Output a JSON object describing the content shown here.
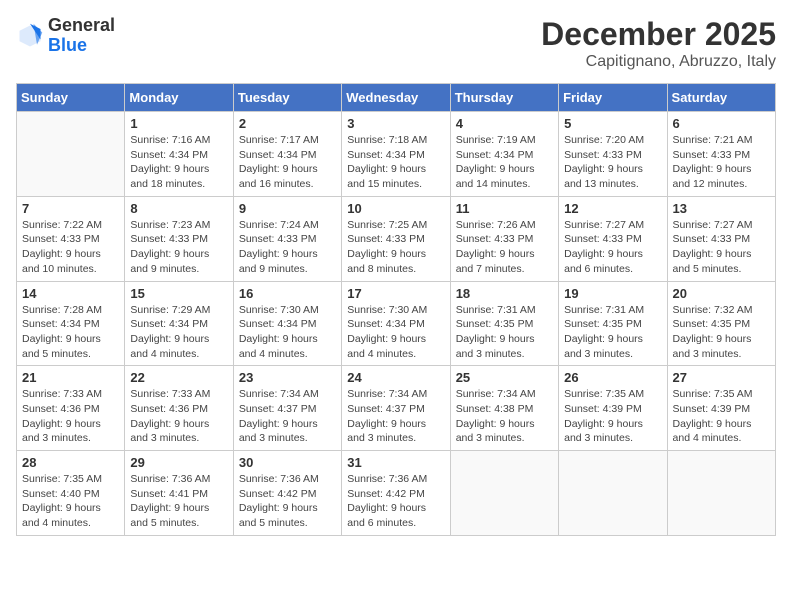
{
  "header": {
    "logo_general": "General",
    "logo_blue": "Blue",
    "month_title": "December 2025",
    "location": "Capitignano, Abruzzo, Italy"
  },
  "days_of_week": [
    "Sunday",
    "Monday",
    "Tuesday",
    "Wednesday",
    "Thursday",
    "Friday",
    "Saturday"
  ],
  "weeks": [
    [
      {
        "day": "",
        "info": ""
      },
      {
        "day": "1",
        "info": "Sunrise: 7:16 AM\nSunset: 4:34 PM\nDaylight: 9 hours\nand 18 minutes."
      },
      {
        "day": "2",
        "info": "Sunrise: 7:17 AM\nSunset: 4:34 PM\nDaylight: 9 hours\nand 16 minutes."
      },
      {
        "day": "3",
        "info": "Sunrise: 7:18 AM\nSunset: 4:34 PM\nDaylight: 9 hours\nand 15 minutes."
      },
      {
        "day": "4",
        "info": "Sunrise: 7:19 AM\nSunset: 4:34 PM\nDaylight: 9 hours\nand 14 minutes."
      },
      {
        "day": "5",
        "info": "Sunrise: 7:20 AM\nSunset: 4:33 PM\nDaylight: 9 hours\nand 13 minutes."
      },
      {
        "day": "6",
        "info": "Sunrise: 7:21 AM\nSunset: 4:33 PM\nDaylight: 9 hours\nand 12 minutes."
      }
    ],
    [
      {
        "day": "7",
        "info": "Sunrise: 7:22 AM\nSunset: 4:33 PM\nDaylight: 9 hours\nand 10 minutes."
      },
      {
        "day": "8",
        "info": "Sunrise: 7:23 AM\nSunset: 4:33 PM\nDaylight: 9 hours\nand 9 minutes."
      },
      {
        "day": "9",
        "info": "Sunrise: 7:24 AM\nSunset: 4:33 PM\nDaylight: 9 hours\nand 9 minutes."
      },
      {
        "day": "10",
        "info": "Sunrise: 7:25 AM\nSunset: 4:33 PM\nDaylight: 9 hours\nand 8 minutes."
      },
      {
        "day": "11",
        "info": "Sunrise: 7:26 AM\nSunset: 4:33 PM\nDaylight: 9 hours\nand 7 minutes."
      },
      {
        "day": "12",
        "info": "Sunrise: 7:27 AM\nSunset: 4:33 PM\nDaylight: 9 hours\nand 6 minutes."
      },
      {
        "day": "13",
        "info": "Sunrise: 7:27 AM\nSunset: 4:33 PM\nDaylight: 9 hours\nand 5 minutes."
      }
    ],
    [
      {
        "day": "14",
        "info": "Sunrise: 7:28 AM\nSunset: 4:34 PM\nDaylight: 9 hours\nand 5 minutes."
      },
      {
        "day": "15",
        "info": "Sunrise: 7:29 AM\nSunset: 4:34 PM\nDaylight: 9 hours\nand 4 minutes."
      },
      {
        "day": "16",
        "info": "Sunrise: 7:30 AM\nSunset: 4:34 PM\nDaylight: 9 hours\nand 4 minutes."
      },
      {
        "day": "17",
        "info": "Sunrise: 7:30 AM\nSunset: 4:34 PM\nDaylight: 9 hours\nand 4 minutes."
      },
      {
        "day": "18",
        "info": "Sunrise: 7:31 AM\nSunset: 4:35 PM\nDaylight: 9 hours\nand 3 minutes."
      },
      {
        "day": "19",
        "info": "Sunrise: 7:31 AM\nSunset: 4:35 PM\nDaylight: 9 hours\nand 3 minutes."
      },
      {
        "day": "20",
        "info": "Sunrise: 7:32 AM\nSunset: 4:35 PM\nDaylight: 9 hours\nand 3 minutes."
      }
    ],
    [
      {
        "day": "21",
        "info": "Sunrise: 7:33 AM\nSunset: 4:36 PM\nDaylight: 9 hours\nand 3 minutes."
      },
      {
        "day": "22",
        "info": "Sunrise: 7:33 AM\nSunset: 4:36 PM\nDaylight: 9 hours\nand 3 minutes."
      },
      {
        "day": "23",
        "info": "Sunrise: 7:34 AM\nSunset: 4:37 PM\nDaylight: 9 hours\nand 3 minutes."
      },
      {
        "day": "24",
        "info": "Sunrise: 7:34 AM\nSunset: 4:37 PM\nDaylight: 9 hours\nand 3 minutes."
      },
      {
        "day": "25",
        "info": "Sunrise: 7:34 AM\nSunset: 4:38 PM\nDaylight: 9 hours\nand 3 minutes."
      },
      {
        "day": "26",
        "info": "Sunrise: 7:35 AM\nSunset: 4:39 PM\nDaylight: 9 hours\nand 3 minutes."
      },
      {
        "day": "27",
        "info": "Sunrise: 7:35 AM\nSunset: 4:39 PM\nDaylight: 9 hours\nand 4 minutes."
      }
    ],
    [
      {
        "day": "28",
        "info": "Sunrise: 7:35 AM\nSunset: 4:40 PM\nDaylight: 9 hours\nand 4 minutes."
      },
      {
        "day": "29",
        "info": "Sunrise: 7:36 AM\nSunset: 4:41 PM\nDaylight: 9 hours\nand 5 minutes."
      },
      {
        "day": "30",
        "info": "Sunrise: 7:36 AM\nSunset: 4:42 PM\nDaylight: 9 hours\nand 5 minutes."
      },
      {
        "day": "31",
        "info": "Sunrise: 7:36 AM\nSunset: 4:42 PM\nDaylight: 9 hours\nand 6 minutes."
      },
      {
        "day": "",
        "info": ""
      },
      {
        "day": "",
        "info": ""
      },
      {
        "day": "",
        "info": ""
      }
    ]
  ]
}
